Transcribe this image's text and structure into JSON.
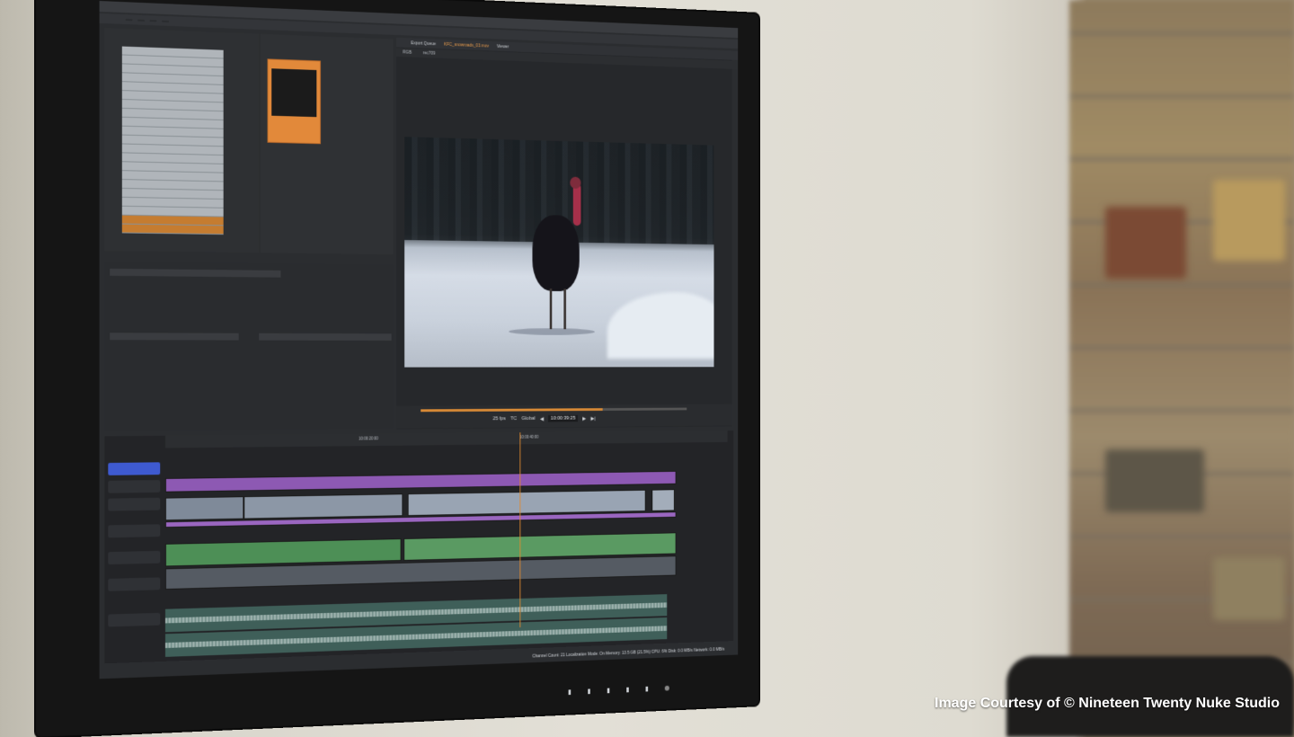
{
  "caption": "Image Courtesy of © Nineteen Twenty Nuke Studio",
  "viewer": {
    "tab_export": "Export Queue",
    "tab_clip": "KFC_snowroads_03.mov",
    "tab_viewer": "Viewer",
    "channel": "RGB",
    "colorspace": "rec709",
    "timecode": "10:00:39:25",
    "fps": "25 fps",
    "tc_mode": "TC",
    "global": "Global"
  },
  "status": "Channel Count: 21 Localization Mode: On Memory: 13.5 GB (21.5%) CPU: 6% Disk: 0.0 MB/s Network: 0.0 MB/s",
  "ruler": {
    "t1": "10:00:20:00",
    "t2": "10:00:40:00"
  }
}
